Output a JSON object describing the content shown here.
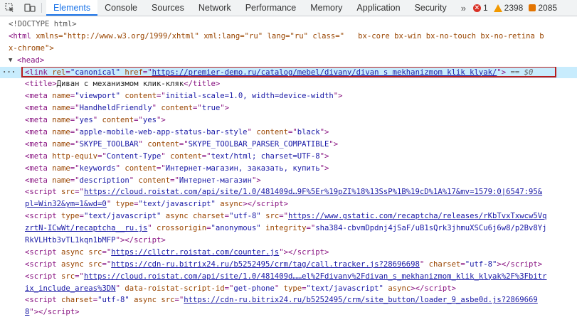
{
  "toolbar": {
    "tabs": [
      "Elements",
      "Console",
      "Sources",
      "Network",
      "Performance",
      "Memory",
      "Application",
      "Security"
    ],
    "more": "»",
    "errors": "1",
    "warnings": "2398",
    "infos": "2085"
  },
  "dom": {
    "doctype": "<!DOCTYPE html>",
    "html_open_1": "xmlns=\"http://www.w3.org/1999/xhtml\" xml:lang=\"ru\" lang=\"ru\" class=\"   bx-core bx-win bx-no-touch bx-no-retina b",
    "html_open_2": "x-chrome\">",
    "head": "<head>",
    "link_href": "https://premier-demo.ru/catalog/mebel/divany/divan_s_mekhanizmom_klik_klyak/",
    "eq0": "== $0",
    "title_text": "Диван с механизмом клик-кляк",
    "meta_viewport": "initial-scale=1.0, width=device-width",
    "meta_handheld_name": "HandheldFriendly",
    "meta_handheld_content": "true",
    "meta_yes_name": "yes",
    "meta_yes_content": "yes",
    "meta_apple_name": "apple-mobile-web-app-status-bar-style",
    "meta_apple_content": "black",
    "meta_skype_name": "SKYPE_TOOLBAR",
    "meta_skype_content": "SKYPE_TOOLBAR_PARSER_COMPATIBLE",
    "meta_http_equiv": "Content-Type",
    "meta_http_content": "text/html; charset=UTF-8",
    "meta_keywords_name": "keywords",
    "meta_keywords_content": "Интернет-магазин, заказать, купить",
    "meta_description_name": "description",
    "meta_description_content": "Интернет-магазин",
    "script1_src_a": "https://cloud.roistat.com/api/site/1.0/481409d…9F%5Er%19pZI%18%13SsP%1B%19cD%1A%17&mv=1579:0|6547:95&",
    "script1_src_b": "pl=Win32&ym=1&wd=0",
    "script2_src_a": "https://www.gstatic.com/recaptcha/releases/rKbTvxTxwcw5Vq",
    "script2_src_b": "zrtN-ICwWt/recaptcha__ru.js",
    "script2_integrity_a": "sha384-cbvmDpdnj4jSaF/uB1sQrk3jhmuXSCu6j6w8/p2Bv8Yj",
    "script2_integrity_b": "RkVLHtb3vTL1kqn1bMFP",
    "script3_src": "https://cllctr.roistat.com/counter.js",
    "script4_src": "https://cdn-ru.bitrix24.ru/b5252495/crm/tag/call.tracker.js?28696698",
    "script5_src_a": "https://cloud.roistat.com/api/site/1.0/481409d……el%2Fdivany%2Fdivan_s_mekhanizmom_klik_klyak%2F%3Fbitr",
    "script5_src_b": "ix_include_areas%3DN",
    "script5_dataid": "get-phone",
    "script6_src_a": "https://cdn-ru.bitrix24.ru/b5252495/crm/site_button/loader_9_asbe0d.js?2869669",
    "script6_src_b": "8"
  },
  "colors": {
    "accent": "#1a73e8",
    "highlight_border": "#b71c1c",
    "selected_row": "#c8ecfd"
  }
}
